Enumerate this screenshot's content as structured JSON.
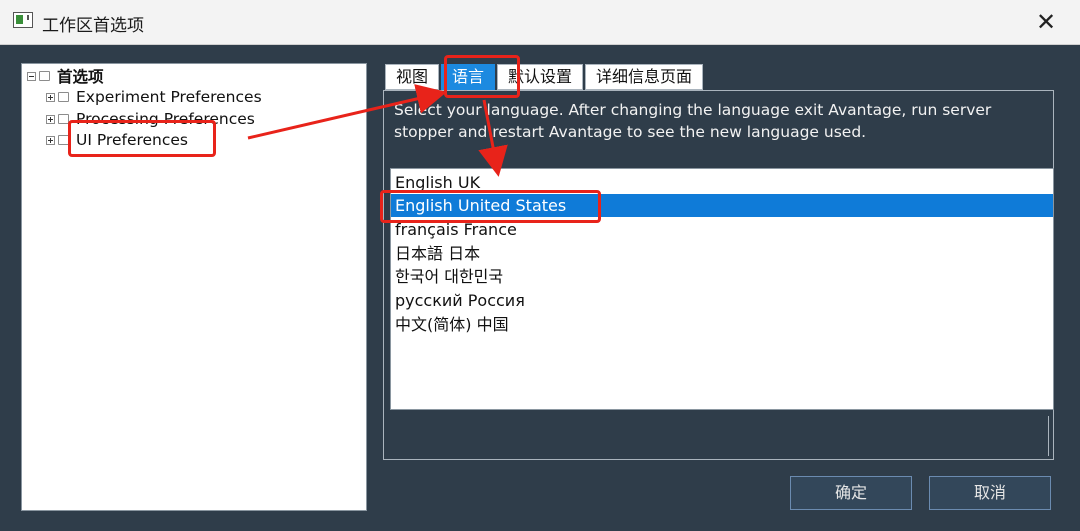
{
  "window": {
    "title": "工作区首选项",
    "close_glyph": "✕"
  },
  "tree": {
    "root_label": "首选项",
    "items": [
      {
        "label": "Experiment Preferences"
      },
      {
        "label": "Processing Preferences"
      },
      {
        "label": "UI Preferences"
      }
    ]
  },
  "tabs": [
    {
      "label": "视图"
    },
    {
      "label": "语言",
      "active": true
    },
    {
      "label": "默认设置"
    },
    {
      "label": "详细信息页面"
    }
  ],
  "language_panel": {
    "description": "Select your language. After changing the language exit Avantage, run server stopper and restart Avantage to see the new language used.",
    "languages": [
      {
        "label": "English UK"
      },
      {
        "label": "English United States",
        "selected": true
      },
      {
        "label": "français France"
      },
      {
        "label": "日本語 日本"
      },
      {
        "label": "한국어 대한민국"
      },
      {
        "label": "русский Россия"
      },
      {
        "label": "中文(简体) 中国"
      }
    ]
  },
  "buttons": {
    "ok": "确定",
    "cancel": "取消"
  },
  "colors": {
    "accent": "#1c8ae0",
    "selection": "#0f7bd8",
    "annotation": "#e8231a",
    "background": "#2f3d4a"
  },
  "icons": {
    "app": "app-window-icon",
    "close": "close-icon",
    "folder": "folder-icon",
    "expander": "tree-expander-icon"
  }
}
